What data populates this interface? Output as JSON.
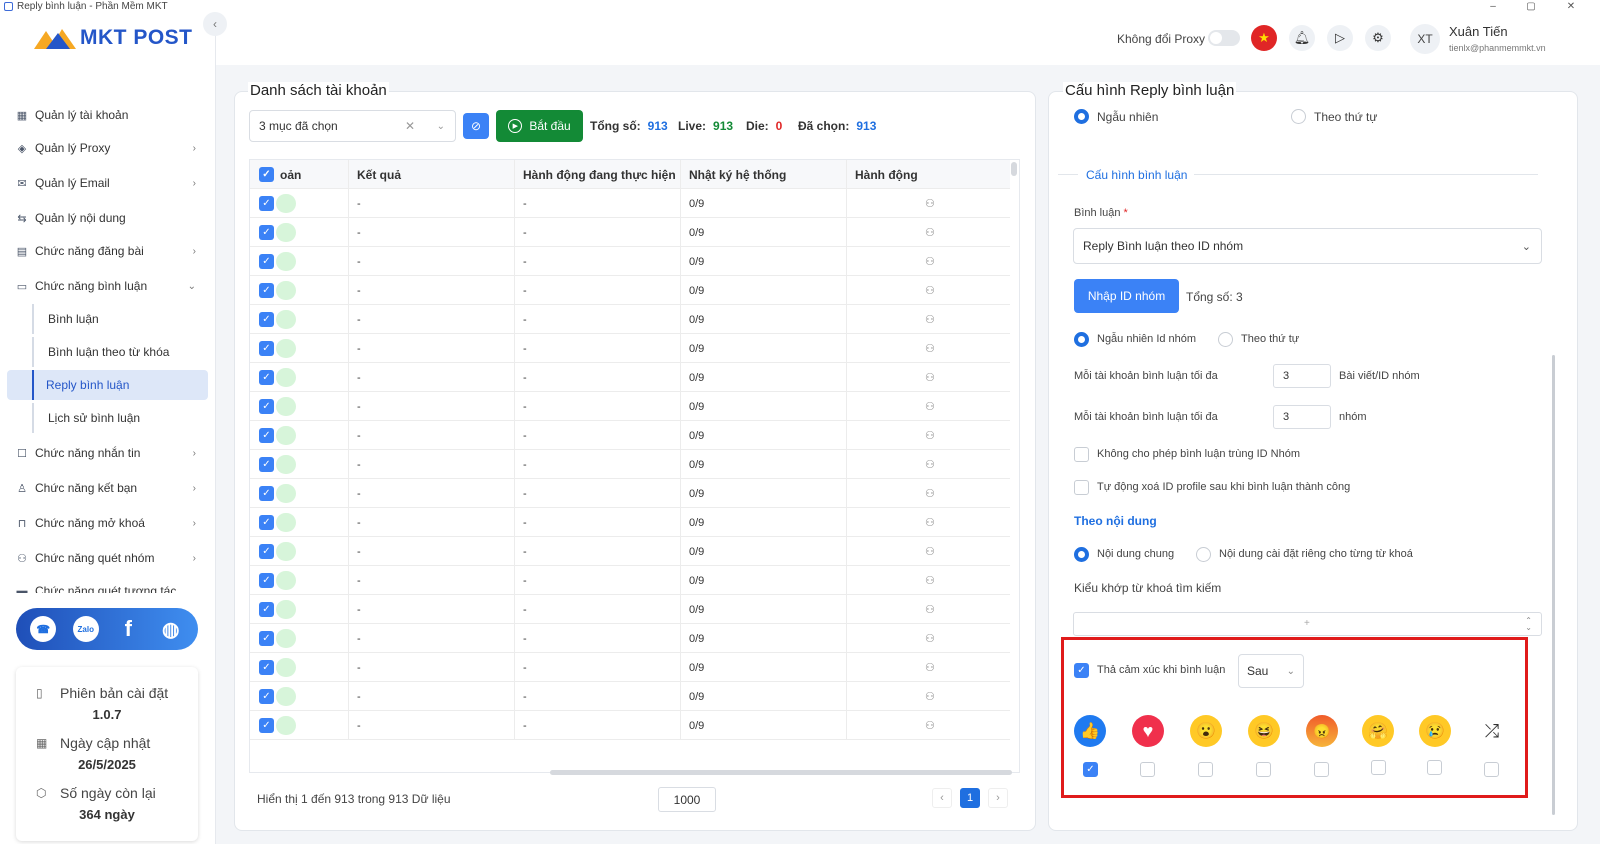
{
  "window": {
    "title": "Reply bình luận - Phần Mềm MKT",
    "controls": [
      "–",
      "▢",
      "✕"
    ]
  },
  "logo": {
    "text": "MKT POST"
  },
  "sidebar": {
    "items": [
      {
        "label": "Quản lý tài khoản",
        "icon": "grid-icon",
        "chev": ""
      },
      {
        "label": "Quản lý Proxy",
        "icon": "proxy-icon",
        "chev": "›"
      },
      {
        "label": "Quản lý Email",
        "icon": "email-icon",
        "chev": "›"
      },
      {
        "label": "Quản lý nội dung",
        "icon": "content-icon",
        "chev": ""
      },
      {
        "label": "Chức năng đăng bài",
        "icon": "post-icon",
        "chev": "›"
      },
      {
        "label": "Chức năng bình luận",
        "icon": "comment-icon",
        "chev": "⌄"
      },
      {
        "label": "Chức năng nhắn tin",
        "icon": "message-icon",
        "chev": "›"
      },
      {
        "label": "Chức năng kết bạn",
        "icon": "add-friend-icon",
        "chev": "›"
      },
      {
        "label": "Chức năng mở khoá",
        "icon": "unlock-icon",
        "chev": "›"
      },
      {
        "label": "Chức năng quét nhóm",
        "icon": "group-icon",
        "chev": "›"
      },
      {
        "label": "Chức năng quét tương tác",
        "icon": "interaction-icon",
        "chev": ""
      }
    ],
    "subitems": [
      "Bình luận",
      "Bình luận theo từ khóa",
      "Reply bình luận",
      "Lịch sử bình luận"
    ]
  },
  "social": {
    "zalo": "Zalo",
    "fb": "f"
  },
  "info": {
    "version_label": "Phiên bản cài đặt",
    "version": "1.0.7",
    "update_label": "Ngày cập nhật",
    "update": "26/5/2025",
    "remain_label": "Số ngày còn lại",
    "remain": "364 ngày"
  },
  "topbar": {
    "proxy_label": "Không đổi Proxy",
    "avatar": "XT",
    "user_name": "Xuân Tiến",
    "user_email": "tienlx@phanmemmkt.vn"
  },
  "accounts": {
    "title": "Danh sách tài khoản",
    "select_value": "3 mục đã chọn",
    "start_label": "Bắt đầu",
    "total_label": "Tổng số:",
    "total": "913",
    "live_label": "Live:",
    "live": "913",
    "die_label": "Die:",
    "die": "0",
    "selected_label": "Đã chọn:",
    "selected": "913",
    "columns": [
      "oản",
      "Kết quả",
      "Hành động đang thực hiện",
      "Nhật ký hệ thống",
      "Hành động"
    ],
    "rows": [
      {
        "result": "-",
        "action": "-",
        "log": "0/9"
      },
      {
        "result": "-",
        "action": "-",
        "log": "0/9"
      },
      {
        "result": "-",
        "action": "-",
        "log": "0/9"
      },
      {
        "result": "-",
        "action": "-",
        "log": "0/9"
      },
      {
        "result": "-",
        "action": "-",
        "log": "0/9"
      },
      {
        "result": "-",
        "action": "-",
        "log": "0/9"
      },
      {
        "result": "-",
        "action": "-",
        "log": "0/9"
      },
      {
        "result": "-",
        "action": "-",
        "log": "0/9"
      },
      {
        "result": "-",
        "action": "-",
        "log": "0/9"
      },
      {
        "result": "-",
        "action": "-",
        "log": "0/9"
      },
      {
        "result": "-",
        "action": "-",
        "log": "0/9"
      },
      {
        "result": "-",
        "action": "-",
        "log": "0/9"
      },
      {
        "result": "-",
        "action": "-",
        "log": "0/9"
      },
      {
        "result": "-",
        "action": "-",
        "log": "0/9"
      },
      {
        "result": "-",
        "action": "-",
        "log": "0/9"
      },
      {
        "result": "-",
        "action": "-",
        "log": "0/9"
      },
      {
        "result": "-",
        "action": "-",
        "log": "0/9"
      },
      {
        "result": "-",
        "action": "-",
        "log": "0/9"
      },
      {
        "result": "-",
        "action": "-",
        "log": "0/9"
      }
    ],
    "footer": "Hiển thị 1 đến 913 trong 913 Dữ liệu",
    "page_size": "1000",
    "page": "1"
  },
  "config": {
    "title": "Cấu hình Reply bình luận",
    "mode_random": "Ngẫu nhiên",
    "mode_order": "Theo thứ tự",
    "section_comment": "Cấu hình bình luận",
    "comment_label": "Bình luận",
    "required_mark": "*",
    "comment_value": "Reply Bình luận theo ID nhóm",
    "input_id_btn": "Nhập ID nhóm",
    "id_total": "Tổng số: 3",
    "id_random": "Ngẫu nhiên Id nhóm",
    "id_order": "Theo thứ tự",
    "max_label_1": "Mỗi tài khoản bình luận tối đa",
    "max_value_1": "3",
    "max_unit_1": "Bài viết/ID nhóm",
    "max_label_2": "Mỗi tài khoản bình luận tối đa",
    "max_value_2": "3",
    "max_unit_2": "nhóm",
    "opt_no_dup": "Không cho phép bình luận trùng ID Nhóm",
    "opt_auto_delete": "Tự động xoá ID profile sau khi bình luận thành công",
    "section_content": "Theo nội dung",
    "content_common": "Nội dung chung",
    "content_per_keyword": "Nội dung cài đặt riêng cho từng từ khoá",
    "keyword_match_label": "Kiểu khớp từ khoá tìm kiếm",
    "react_label": "Thả cảm xúc khi bình luận",
    "react_timing": "Sau",
    "reactions": [
      {
        "name": "like",
        "glyph": "👍",
        "checked": true
      },
      {
        "name": "love",
        "glyph": "♥",
        "checked": false
      },
      {
        "name": "wow",
        "glyph": "😮",
        "checked": false
      },
      {
        "name": "haha",
        "glyph": "😆",
        "checked": false
      },
      {
        "name": "angry",
        "glyph": "😠",
        "checked": false
      },
      {
        "name": "care",
        "glyph": "🤗",
        "checked": false
      },
      {
        "name": "sad",
        "glyph": "😢",
        "checked": false
      },
      {
        "name": "random",
        "glyph": "⤮",
        "checked": false
      }
    ]
  }
}
